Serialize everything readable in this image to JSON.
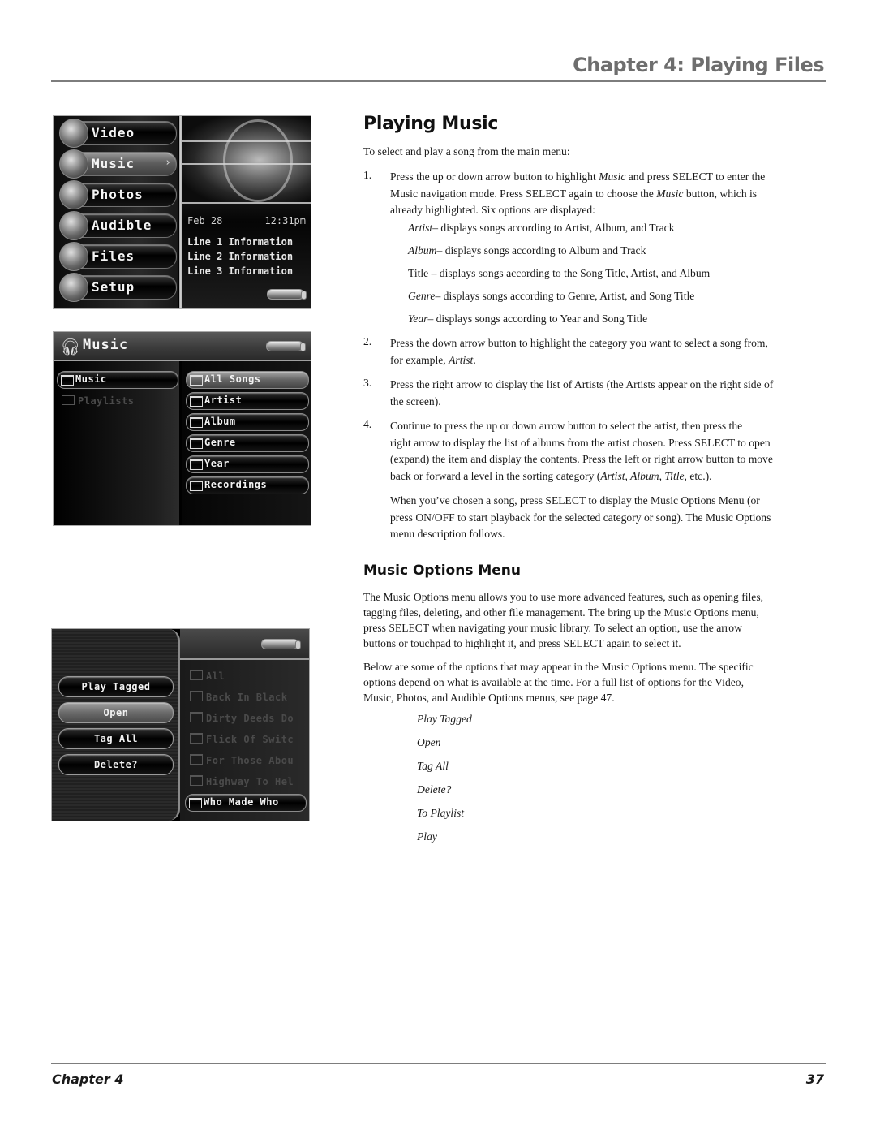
{
  "header": {
    "title": "Chapter 4: Playing Files"
  },
  "footer": {
    "chapter": "Chapter 4",
    "page_number": "37"
  },
  "screen_main_menu": {
    "items": [
      {
        "label": "Video",
        "icon": "camcorder-icon",
        "active": false
      },
      {
        "label": "Music",
        "icon": "headphones-icon",
        "active": true
      },
      {
        "label": "Photos",
        "icon": "camera-icon",
        "active": false
      },
      {
        "label": "Audible",
        "icon": "speaker-book-icon",
        "active": false
      },
      {
        "label": "Files",
        "icon": "folder-icon",
        "active": false
      },
      {
        "label": "Setup",
        "icon": "gear-icon",
        "active": false
      }
    ],
    "date": "Feb 28",
    "time": "12:31pm",
    "info_lines": [
      "Line 1 Information",
      "Line 2 Information",
      "Line 3 Information"
    ],
    "chevron": "›"
  },
  "screen_music_nav": {
    "title": "Music",
    "left_items": [
      {
        "label": "Music",
        "selected": true
      },
      {
        "label": "Playlists",
        "selected": false
      }
    ],
    "right_items": [
      {
        "label": "All Songs",
        "active": true
      },
      {
        "label": "Artist",
        "active": false
      },
      {
        "label": "Album",
        "active": false
      },
      {
        "label": "Genre",
        "active": false
      },
      {
        "label": "Year",
        "active": false
      },
      {
        "label": "Recordings",
        "active": false
      }
    ]
  },
  "screen_options_menu": {
    "options": [
      {
        "label": "Play Tagged",
        "active": false
      },
      {
        "label": "Open",
        "active": true
      },
      {
        "label": "Tag All",
        "active": false
      },
      {
        "label": "Delete?",
        "active": false
      }
    ],
    "list_items": [
      "All",
      "Back In Black",
      "Dirty Deeds Do",
      "Flick Of Switc",
      "For Those Abou",
      "Highway To Hel",
      "Who Made Who"
    ]
  },
  "section_playing_music": {
    "heading": "Playing Music",
    "intro": "To select and play a song from the main menu:",
    "step1": {
      "number": "1.",
      "line1_a": "Press the up or down arrow button to highlight ",
      "line1_em": "Music",
      "line1_b": " and press SELECT to enter the",
      "line2_a": "Music navigation mode. Press SELECT again to choose the ",
      "line2_em": "Music",
      "line2_b": " button, which is",
      "line3": "already highlighted. Six options are displayed:"
    },
    "options": [
      {
        "name": "Artist",
        "italic": true,
        "desc": "– displays songs according to Artist, Album, and Track"
      },
      {
        "name": "Album",
        "italic": true,
        "desc": "– displays songs according to Album and Track"
      },
      {
        "name": "Title",
        "italic": false,
        "desc": " – displays songs according to the Song Title, Artist, and Album"
      },
      {
        "name": "Genre",
        "italic": true,
        "desc": "– displays songs according to Genre, Artist, and Song Title"
      },
      {
        "name": "Year",
        "italic": true,
        "desc": "– displays songs according to Year and Song Title"
      }
    ],
    "step2": {
      "number": "2.",
      "line1": "Press the down arrow button to highlight the category you want to select a song from,",
      "line2_a": "for example, ",
      "line2_em": "Artist",
      "line2_b": "."
    },
    "step3": {
      "number": "3.",
      "line1": "Press the right arrow to display the list of Artists (the Artists appear on the right side of",
      "line2": "the screen)."
    },
    "step4": {
      "number": "4.",
      "line1": "Continue to press the up or down arrow button to select the artist, then press the",
      "line2": "right arrow to display the list of albums from the artist chosen. Press SELECT to open",
      "line3": "(expand) the item and display the contents. Press the left or right arrow button to move",
      "line4_a": "back or forward a level in the sorting category (",
      "line4_em": "Artist, Album, Title",
      "line4_b": ", etc.)."
    },
    "followup": {
      "line1": "When you’ve chosen a song, press SELECT to display the Music Options Menu (or",
      "line2": "press ON/OFF to start playback for the selected category or song). The Music Options",
      "line3": "menu description follows."
    }
  },
  "section_options_menu": {
    "heading": "Music Options Menu",
    "para1": [
      "The Music Options menu allows you to use more advanced features, such as opening files,",
      "tagging files, deleting, and other file management. The bring up the Music Options menu,",
      "press SELECT when navigating your music library. To select an option, use the arrow",
      "buttons or touchpad to highlight it, and press SELECT again to select it."
    ],
    "para2": [
      "Below are some of the options that may appear in the Music Options menu.  The specific",
      "options depend on what is available at the time. For a full list of options for the Video,",
      "Music, Photos, and Audible Options menus, see page 47."
    ],
    "option_list": [
      "Play Tagged",
      "Open",
      "Tag All",
      "Delete?",
      "To Playlist",
      "Play"
    ]
  }
}
